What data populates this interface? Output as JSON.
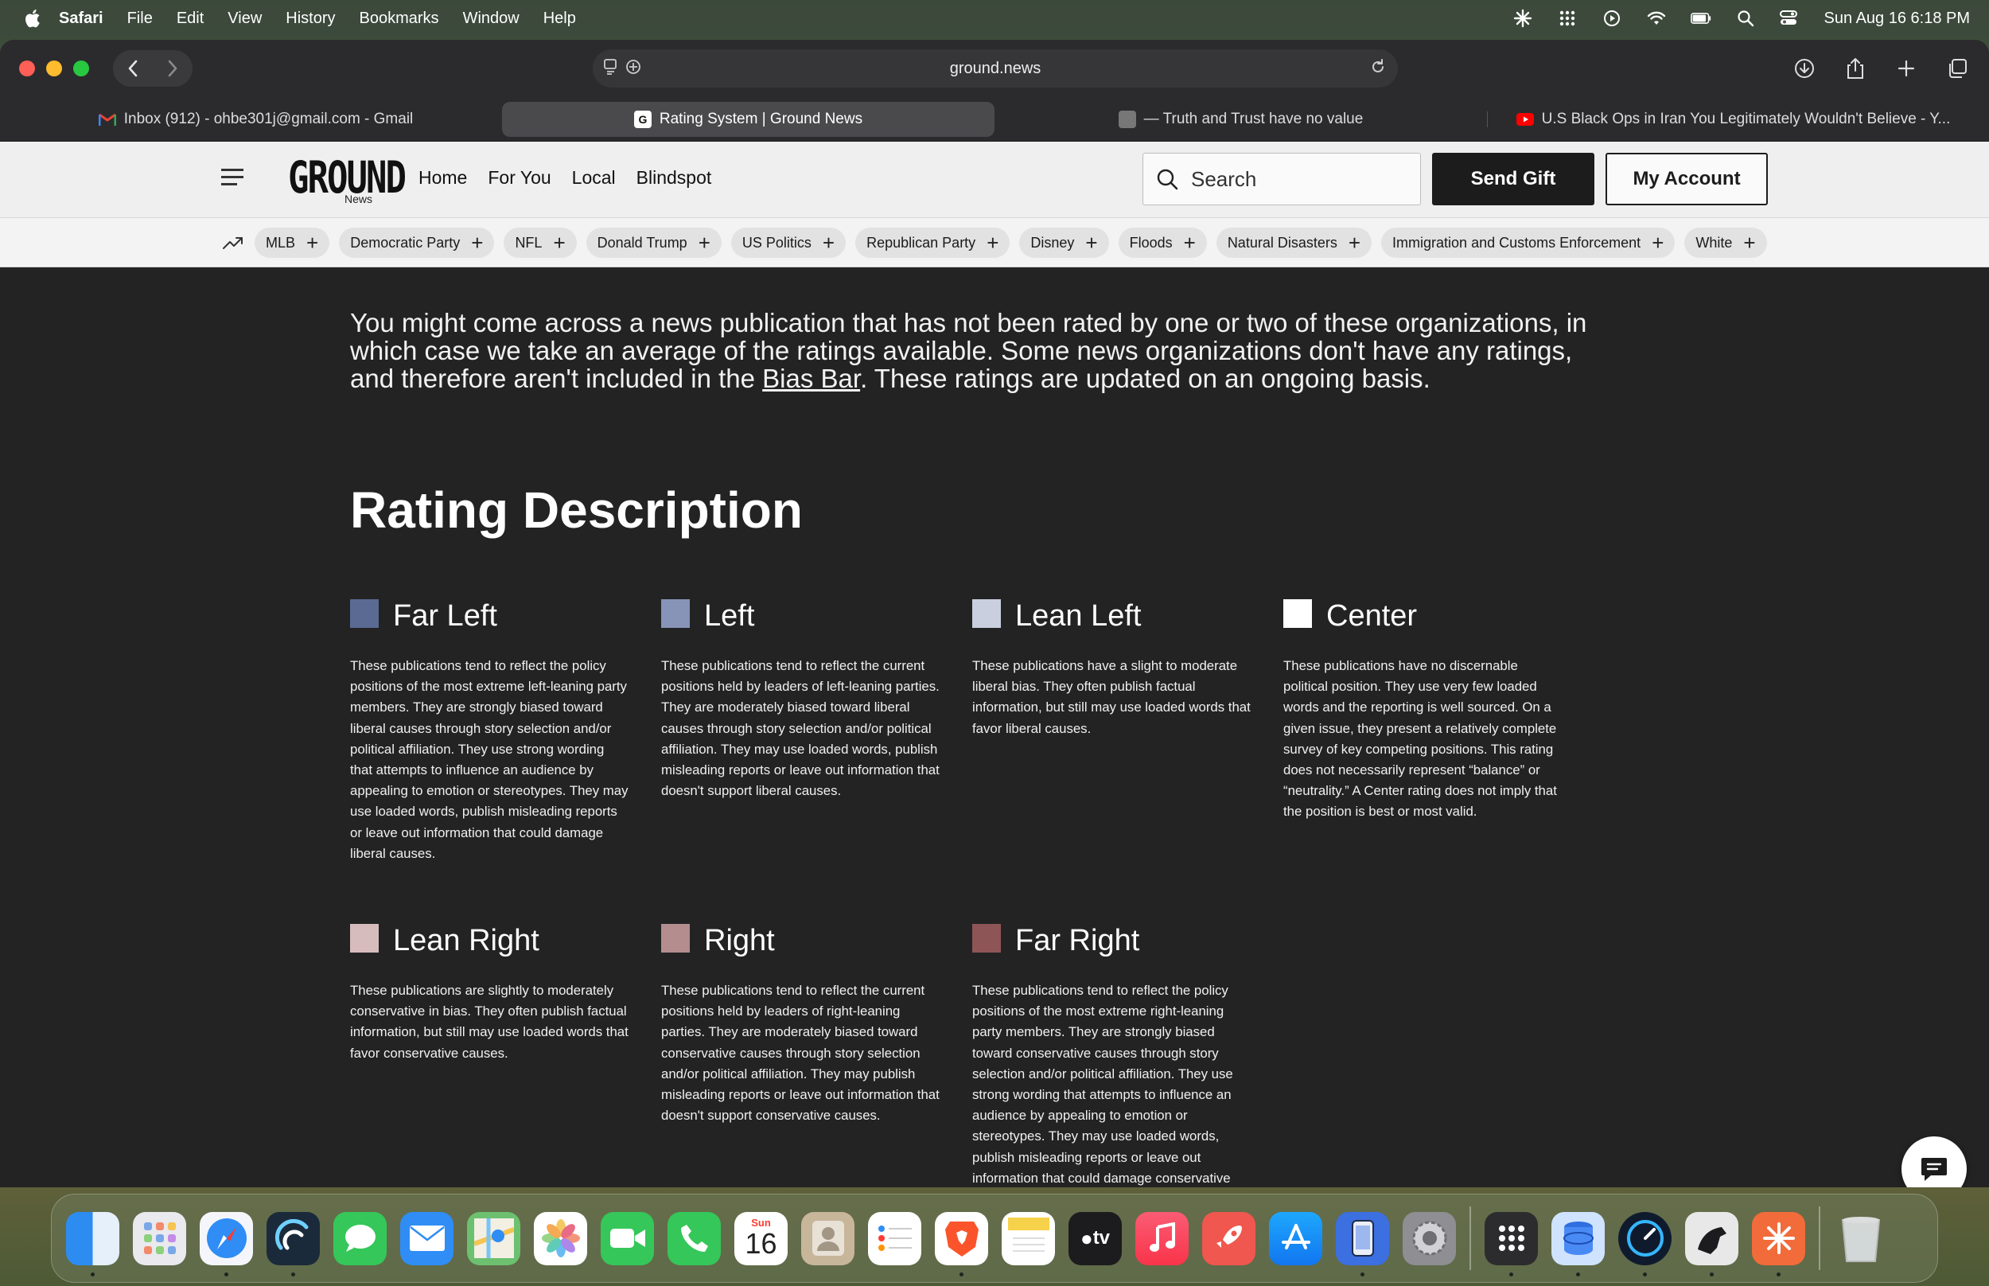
{
  "menubar": {
    "app_name": "Safari",
    "menus": [
      "File",
      "Edit",
      "View",
      "History",
      "Bookmarks",
      "Window",
      "Help"
    ],
    "clock": "Sun Aug 16  6:18 PM"
  },
  "browser": {
    "url": "ground.news",
    "tabs": [
      {
        "title": "Inbox (912) - ohbe301j@gmail.com - Gmail",
        "favicon": "gmail-icon"
      },
      {
        "title": "Rating System | Ground News",
        "favicon": "ground-news-icon"
      },
      {
        "title": "— Truth and Trust have no value",
        "favicon": "page-icon"
      },
      {
        "title": "U.S Black Ops in Iran You Legitimately Wouldn't Believe - Y...",
        "favicon": "youtube-icon"
      }
    ]
  },
  "site": {
    "logo_word": "GROUND",
    "logo_sub": "News",
    "nav": [
      "Home",
      "For You",
      "Local",
      "Blindspot"
    ],
    "search_placeholder": "Search",
    "send_gift": "Send Gift",
    "my_account": "My Account",
    "topics": [
      "MLB",
      "Democratic Party",
      "NFL",
      "Donald Trump",
      "US Politics",
      "Republican Party",
      "Disney",
      "Floods",
      "Natural Disasters",
      "Immigration and Customs Enforcement",
      "White"
    ]
  },
  "content": {
    "intro_before": "You might come across a news publication that has not been rated by one or two of these organizations, in which case we take an average of the ratings available. Some news organizations don't have any ratings, and therefore aren't included in the ",
    "intro_link": "Bias Bar",
    "intro_after": ". These ratings are updated on an ongoing basis.",
    "section_title": "Rating Description",
    "ratings": [
      {
        "name": "Far Left",
        "color": "#5a6a93",
        "description": "These publications tend to reflect the policy positions of the most extreme left-leaning party members. They are strongly biased toward liberal causes through story selection and/or political affiliation. They use strong wording that attempts to influence an audience by appealing to emotion or stereotypes. They may use loaded words, publish misleading reports or leave out information that could damage liberal causes."
      },
      {
        "name": "Left",
        "color": "#8794b8",
        "description": "These publications tend to reflect the current positions held by leaders of left-leaning parties. They are moderately biased toward liberal causes through story selection and/or political affiliation. They may use loaded words, publish misleading reports or leave out information that doesn't support liberal causes."
      },
      {
        "name": "Lean Left",
        "color": "#c9cfdf",
        "description": "These publications have a slight to moderate liberal bias. They often publish factual information, but still may use loaded words that favor liberal causes."
      },
      {
        "name": "Center",
        "color": "#ffffff",
        "description": "These publications have no discernable political position. They use very few loaded words and the reporting is well sourced. On a given issue, they present a relatively complete survey of key competing positions. This rating does not necessarily represent “balance” or “neutrality.” A Center rating does not imply that the position is best or most valid."
      },
      {
        "name": "Lean Right",
        "color": "#d7bcbd",
        "description": "These publications are slightly to moderately conservative in bias. They often publish factual information, but still may use loaded words that favor conservative causes."
      },
      {
        "name": "Right",
        "color": "#b48d8f",
        "description": "These publications tend to reflect the current positions held by leaders of right-leaning parties. They are moderately biased toward conservative causes through story selection and/or political affiliation. They may publish misleading reports or leave out information that doesn't support conservative causes."
      },
      {
        "name": "Far Right",
        "color": "#8e5556",
        "description": "These publications tend to reflect the policy positions of the most extreme right-leaning party members. They are strongly biased toward conservative causes through story selection and/or political affiliation. They use strong wording that attempts to influence an audience by appealing to emotion or stereotypes. They may use loaded words, publish misleading reports or leave out information that could damage conservative causes."
      }
    ]
  },
  "dock": {
    "calendar_month": "Sun",
    "calendar_day": "16",
    "tv_label": "tv",
    "apps": [
      "finder-icon",
      "launchpad-icon",
      "safari-icon",
      "podcast-app-icon",
      "messages-icon",
      "mail-icon",
      "maps-icon",
      "photos-icon",
      "facetime-icon",
      "phone-icon",
      "calendar-icon",
      "contacts-icon",
      "reminders-icon",
      "brave-icon",
      "notes-icon",
      "tv-icon",
      "music-icon",
      "rocket-icon",
      "app-store-icon",
      "simulator-icon",
      "system-settings-icon",
      "grid-app-icon",
      "database-app-icon",
      "speedtest-icon",
      "horse-app-icon",
      "claude-icon",
      "trash-icon"
    ]
  }
}
